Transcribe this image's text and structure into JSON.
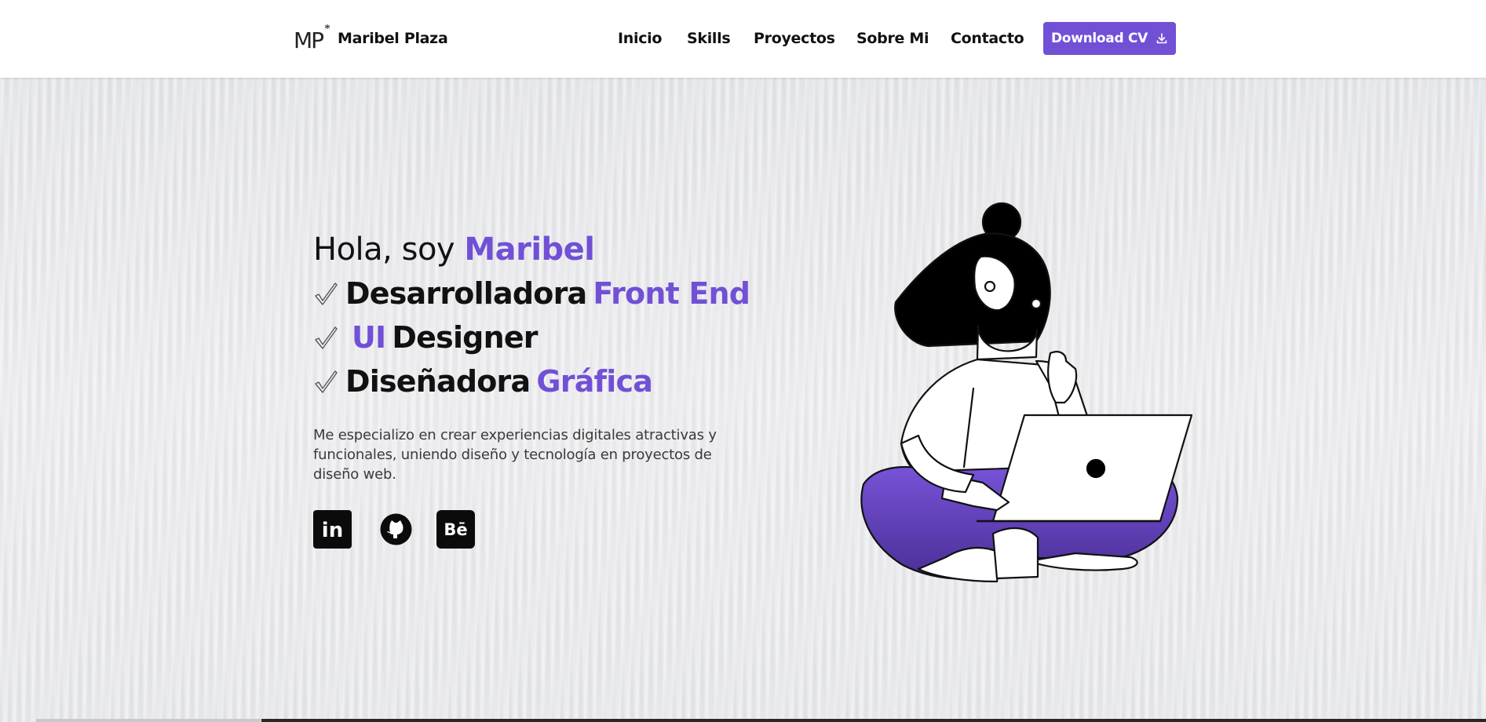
{
  "brand": {
    "logo_text": "MP",
    "name": "Maribel Plaza"
  },
  "nav": {
    "items": [
      {
        "label": "Inicio"
      },
      {
        "label": "Skills"
      },
      {
        "label": "Proyectos"
      },
      {
        "label": "Sobre Mi"
      },
      {
        "label": "Contacto"
      }
    ],
    "cv_button": {
      "label": "Download CV",
      "icon": "download-icon"
    }
  },
  "hero": {
    "greeting_prefix": "Hola, soy ",
    "greeting_name": "Maribel",
    "roles": [
      {
        "before": "",
        "main": "Desarrolladora",
        "accent": "Front End"
      },
      {
        "accent_first": "UI",
        "main": "Designer"
      },
      {
        "main": "Diseñadora",
        "accent": "Gráfica"
      }
    ],
    "role_icon": "checkmark-icon",
    "description": "Me especializo en crear experiencias digitales atractivas y funcionales, uniendo diseño y tecnología en proyectos de diseño web."
  },
  "socials": [
    {
      "name": "linkedin-icon",
      "label": "in"
    },
    {
      "name": "github-icon"
    },
    {
      "name": "behance-icon",
      "label": "Bē"
    }
  ],
  "colors": {
    "accent": "#7150d6",
    "text": "#111111",
    "background": "#e6e7ea",
    "header": "#ffffff"
  }
}
